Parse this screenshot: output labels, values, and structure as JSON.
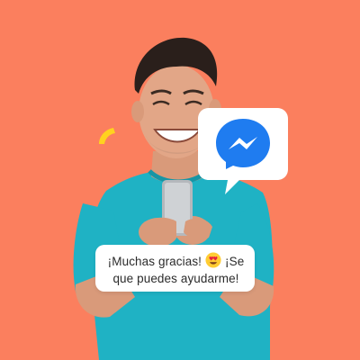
{
  "colors": {
    "background": "#fb7f5e",
    "messenger_blue": "#1f7cf0",
    "bubble_white": "#ffffff",
    "sparkle_yellow": "#ffd21f",
    "shirt_teal": "#1fb2c4"
  },
  "icons": {
    "messenger": "messenger-logo-icon",
    "emoji": "heart-eyes-emoji-icon",
    "sparkle": "sparkle-icon"
  },
  "chat_message": {
    "line1_before_emoji": "¡Muchas gracias!",
    "line1_after_emoji": "¡Se",
    "line2": "que puedes ayudarme!"
  }
}
